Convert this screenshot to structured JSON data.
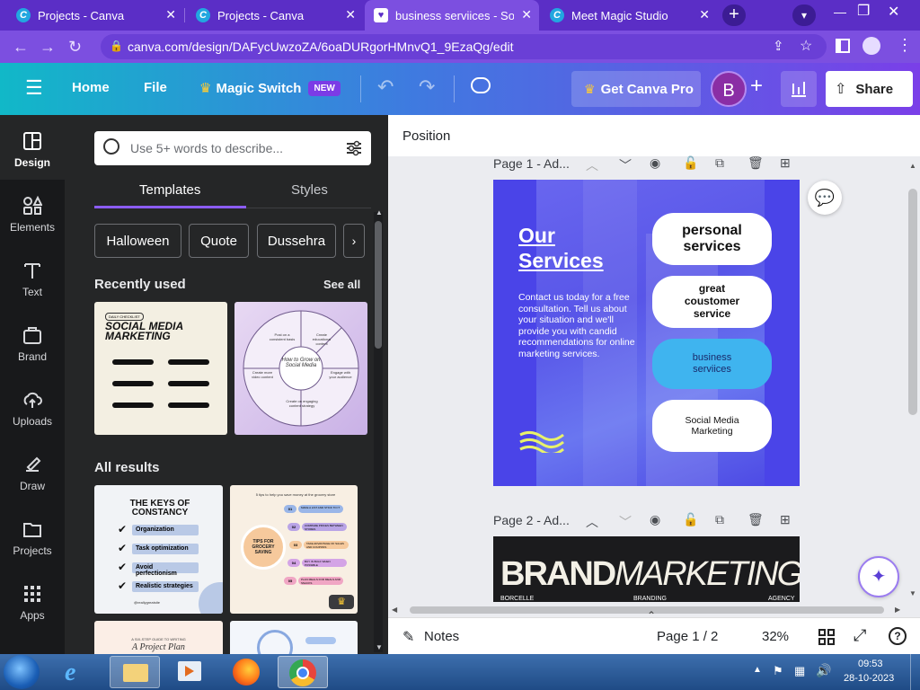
{
  "browser": {
    "tabs": [
      {
        "title": "Projects - Canva",
        "active": false
      },
      {
        "title": "Projects - Canva",
        "active": false
      },
      {
        "title": "business serviices - Social",
        "active": true
      },
      {
        "title": "Meet Magic Studio",
        "active": false
      }
    ],
    "url": "canva.com/design/DAFycUwzoZA/6oaDURgorHMnvQ1_9EzaQg/edit"
  },
  "header": {
    "home": "Home",
    "file": "File",
    "magic_switch": "Magic Switch",
    "new_badge": "NEW",
    "get_pro": "Get Canva Pro",
    "avatar": "B",
    "share": "Share"
  },
  "rail": [
    {
      "label": "Design",
      "icon": "design-icon"
    },
    {
      "label": "Elements",
      "icon": "elements-icon"
    },
    {
      "label": "Text",
      "icon": "text-icon"
    },
    {
      "label": "Brand",
      "icon": "brand-icon"
    },
    {
      "label": "Uploads",
      "icon": "uploads-icon"
    },
    {
      "label": "Draw",
      "icon": "draw-icon"
    },
    {
      "label": "Projects",
      "icon": "projects-icon"
    },
    {
      "label": "Apps",
      "icon": "apps-icon"
    }
  ],
  "panel": {
    "search_placeholder": "Use 5+ words to describe...",
    "tabs": [
      "Templates",
      "Styles"
    ],
    "chips": [
      "Halloween",
      "Quote",
      "Dussehra"
    ],
    "recently_used": "Recently used",
    "see_all": "See all",
    "all_results": "All results",
    "thumbs": {
      "t1_tag": "DAILY CHECKLIST",
      "t1_title": "SOCIAL MEDIA MARKETING",
      "t2_center": "How to Grow on Social Media",
      "t2_seg1": "Post on a consistent basis",
      "t2_seg2": "Create educational content",
      "t2_seg3": "Engage with your audience",
      "t2_seg4": "Create on engaging content strategy",
      "t2_seg5": "Create more video content",
      "t3_title": "THE KEYS OF CONSTANCY",
      "t3_items": [
        "Organization",
        "Task optimization",
        "Avoid perfectionism",
        "Realistic strategies"
      ],
      "t3_handle": "@reallygreatsite",
      "t4_head": "5 tips to help you save money at the grocery store",
      "t4_center": "TIPS FOR GROCERY SAVING",
      "t4_items": [
        "MAKE A LIST AND STICK TO IT",
        "COMPARE PRICES BETWEEN STORES",
        "TAKE ADVANTAGE OF SALES AND COUPONS",
        "BUY IN BULK WHEN POSSIBLE",
        "PLAN MEALS FOR MEALS AND SNACKS"
      ],
      "t4_nums": [
        "01",
        "02",
        "03",
        "04",
        "05"
      ],
      "t5_line1": "A SIX-STEP GUIDE TO WRITING",
      "t5_line2": "A Project Plan"
    }
  },
  "editor": {
    "position": "Position",
    "page1_label": "Page 1 - Ad...",
    "page2_label": "Page 2 - Ad...",
    "notes": "Notes",
    "page_indicator": "Page 1 / 2",
    "zoom": "32%"
  },
  "design": {
    "title_line1": "Our",
    "title_line2": "Services",
    "body": "Contact us today for a free consultation. Tell us about your situation and we'll provide you with candid recommendations for online marketing services.",
    "pills": [
      "personal services",
      "great coustomer service",
      "business serviices",
      "Social Media Marketing"
    ],
    "page2_title_a": "BRAND",
    "page2_title_b": "MARKETING",
    "page2_labels": [
      "BORCELLE",
      "BRANDING",
      "AGENCY"
    ]
  },
  "taskbar": {
    "time": "09:53",
    "date": "28-10-2023"
  },
  "colors": {
    "chrome_tab": "#5b2ec6",
    "canva_rail": "#18191b",
    "design_bg": "#4a44e8",
    "pill_highlight": "#3fb4ef"
  }
}
